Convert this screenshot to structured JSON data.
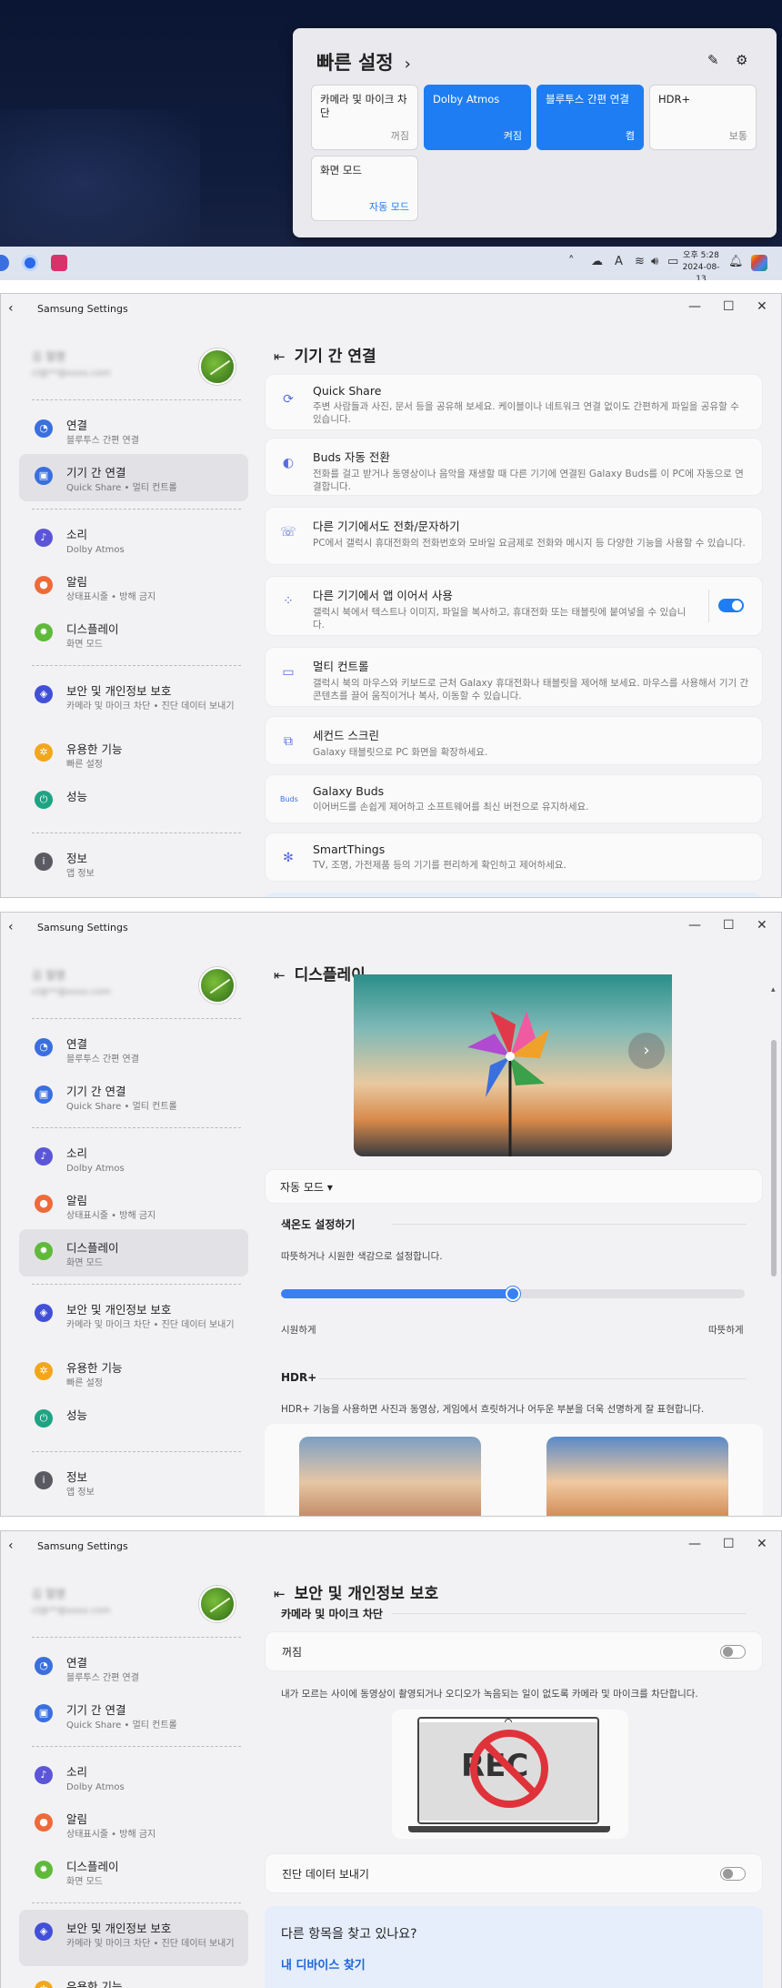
{
  "desktop": {
    "quick_settings": {
      "title": "빠른 설정",
      "chevron": "›",
      "tiles": [
        {
          "label": "카메라 및 마이크 차단",
          "state": "꺼짐",
          "active": false
        },
        {
          "label": "Dolby Atmos",
          "state": "켜짐",
          "active": true
        },
        {
          "label": "블루투스 간편 연결",
          "state": "켬",
          "active": true
        },
        {
          "label": "HDR+",
          "state": "보통",
          "active": false
        },
        {
          "label": "화면 모드",
          "state": "자동 모드",
          "active": false
        }
      ]
    },
    "taskbar": {
      "time": "오후 5:28",
      "date": "2024-08-13",
      "ime": "A"
    }
  },
  "app": {
    "title": "Samsung Settings",
    "profile": {
      "name": "김 철명",
      "email": "cl@**@xxxx.com"
    }
  },
  "sidebar": {
    "items": [
      {
        "label": "연결",
        "sub": "블루투스 간편 연결",
        "icon": "wifi-icon",
        "color": "#3a6fdf"
      },
      {
        "label": "기기 간 연결",
        "sub": "Quick Share  •  멀티 컨트롤",
        "icon": "devices-icon",
        "color": "#3a6fdf"
      },
      {
        "label": "소리",
        "sub": "Dolby Atmos",
        "icon": "speaker-icon",
        "color": "#5b55d8"
      },
      {
        "label": "알림",
        "sub": "상태표시줄  •  방해 금지",
        "icon": "bell-icon",
        "color": "#ef6a3a"
      },
      {
        "label": "디스플레이",
        "sub": "화면 모드",
        "icon": "sun-icon",
        "color": "#5fb93a"
      },
      {
        "label": "보안 및 개인정보 보호",
        "sub": "카메라 및 마이크 차단  •  진단 데이터 보내기",
        "icon": "shield-icon",
        "color": "#4250d8"
      },
      {
        "label": "유용한 기능",
        "sub": "빠른 설정",
        "icon": "gear-icon",
        "color": "#f2a71b"
      },
      {
        "label": "성능",
        "sub": "",
        "icon": "power-icon",
        "color": "#1fa483"
      },
      {
        "label": "정보",
        "sub": "앱 정보",
        "icon": "info-icon",
        "color": "#5a5a62"
      }
    ]
  },
  "connect_page": {
    "title": "기기 간 연결",
    "cards": [
      {
        "title": "Quick Share",
        "desc": "주변 사람들과 사진, 문서 등을 공유해 보세요. 케이블이나 네트워크 연결 없이도 간편하게 파일을 공유할 수 있습니다."
      },
      {
        "title": "Buds 자동 전환",
        "desc": "전화를 걸고 받거나 동영상이나 음악을 재생할 때 다른 기기에 연결된 Galaxy Buds를 이 PC에 자동으로 연결합니다."
      },
      {
        "title": "다른 기기에서도 전화/문자하기",
        "desc": "PC에서 갤럭시 휴대전화의 전화번호와 모바일 요금제로 전화와 메시지 등 다양한 기능을 사용할 수 있습니다."
      },
      {
        "title": "다른 기기에서 앱 이어서 사용",
        "desc": "갤럭시 북에서 텍스트나 이미지, 파일을 복사하고, 휴대전화 또는 태블릿에 붙여넣을 수 있습니다."
      },
      {
        "title": "멀티 컨트롤",
        "desc": "갤럭시 북의 마우스와 키보드로 근처 Galaxy 휴대전화나 태블릿을 제어해 보세요. 마우스를 사용해서 기기 간 콘텐츠를 끌어 움직이거나 복사, 이동할 수 있습니다."
      },
      {
        "title": "세컨드 스크린",
        "desc": "Galaxy 태블릿으로 PC 화면을 확장하세요."
      },
      {
        "title": "Galaxy Buds",
        "desc": "이어버드를 손쉽게 제어하고 소프트웨어를 최신 버전으로 유지하세요."
      },
      {
        "title": "SmartThings",
        "desc": "TV, 조명, 가전제품 등의 기기를 편리하게 확인하고 제어하세요."
      }
    ],
    "buds_icon_text": "Buds"
  },
  "display_page": {
    "title": "디스플레이",
    "mode": "자동 모드",
    "color_temp_title": "색온도 설정하기",
    "color_temp_desc": "따뜻하거나 시원한 색감으로 설정합니다.",
    "slider_value": 0.5,
    "cool_label": "시원하게",
    "warm_label": "따뜻하게",
    "hdr_title": "HDR+",
    "hdr_desc": "HDR+ 기능을 사용하면 사진과 동영상, 게임에서 흐릿하거나 어두운 부분을 더욱 선명하게 잘 표현합니다."
  },
  "security_page": {
    "title": "보안 및 개인정보 보호",
    "section": "카메라 및 마이크 차단",
    "camera_state": "꺼짐",
    "camera_desc": "내가 모르는 사이에 동영상이 촬영되거나 오디오가 녹음되는 일이 없도록 카메라 및 마이크를 차단합니다.",
    "rec_text": "REC",
    "diag_label": "진단 데이터 보내기",
    "find_title": "다른 항목을 찾고 있나요?",
    "find_link": "내 디바이스 찾기"
  },
  "window_controls": {
    "min": "—",
    "max": "☐",
    "close": "✕",
    "back": "‹",
    "collapse": "⇤"
  }
}
